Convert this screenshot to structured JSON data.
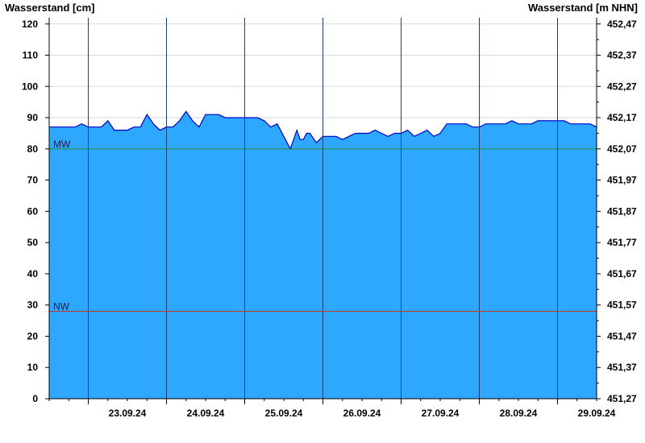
{
  "chart_data": {
    "type": "area",
    "y_left_label": "Wasserstand [cm]",
    "y_right_label": "Wasserstand [m NHN]",
    "ylim": [
      0,
      122
    ],
    "yticks_left": [
      0,
      10,
      20,
      30,
      40,
      50,
      60,
      70,
      80,
      90,
      100,
      110,
      120
    ],
    "yticks_right": [
      "451,27",
      "451,37",
      "451,47",
      "451,57",
      "451,67",
      "451,77",
      "451,87",
      "451,97",
      "452,07",
      "452,17",
      "452,27",
      "452,37",
      "452,47"
    ],
    "x_range": [
      "2024-09-22T12:00",
      "2024-09-29T12:00"
    ],
    "x_tick_labels": [
      "23.09.24",
      "24.09.24",
      "25.09.24",
      "26.09.24",
      "27.09.24",
      "28.09.24",
      "29.09.24"
    ],
    "x_day_boundaries": [
      "2024-09-23",
      "2024-09-24",
      "2024-09-25",
      "2024-09-26",
      "2024-09-27",
      "2024-09-28",
      "2024-09-29"
    ],
    "reference_lines": [
      {
        "label": "MW",
        "value": 80,
        "color": "#2e8b2e"
      },
      {
        "label": "NW",
        "value": 28,
        "color": "#c0392b"
      }
    ],
    "series": [
      {
        "fill": "#2ea7ff",
        "stroke": "#0000c8",
        "x": [
          "2024-09-22T12:00",
          "2024-09-22T14:00",
          "2024-09-22T16:00",
          "2024-09-22T18:00",
          "2024-09-22T20:00",
          "2024-09-22T22:00",
          "2024-09-23T00:00",
          "2024-09-23T02:00",
          "2024-09-23T04:00",
          "2024-09-23T06:00",
          "2024-09-23T08:00",
          "2024-09-23T10:00",
          "2024-09-23T12:00",
          "2024-09-23T14:00",
          "2024-09-23T16:00",
          "2024-09-23T18:00",
          "2024-09-23T20:00",
          "2024-09-23T22:00",
          "2024-09-24T00:00",
          "2024-09-24T02:00",
          "2024-09-24T04:00",
          "2024-09-24T06:00",
          "2024-09-24T08:00",
          "2024-09-24T10:00",
          "2024-09-24T12:00",
          "2024-09-24T14:00",
          "2024-09-24T16:00",
          "2024-09-24T18:00",
          "2024-09-24T20:00",
          "2024-09-24T22:00",
          "2024-09-25T00:00",
          "2024-09-25T02:00",
          "2024-09-25T04:00",
          "2024-09-25T06:00",
          "2024-09-25T08:00",
          "2024-09-25T10:00",
          "2024-09-25T12:00",
          "2024-09-25T14:00",
          "2024-09-25T16:00",
          "2024-09-25T17:00",
          "2024-09-25T18:00",
          "2024-09-25T19:00",
          "2024-09-25T20:00",
          "2024-09-25T22:00",
          "2024-09-26T00:00",
          "2024-09-26T02:00",
          "2024-09-26T04:00",
          "2024-09-26T06:00",
          "2024-09-26T08:00",
          "2024-09-26T10:00",
          "2024-09-26T12:00",
          "2024-09-26T14:00",
          "2024-09-26T16:00",
          "2024-09-26T18:00",
          "2024-09-26T20:00",
          "2024-09-26T22:00",
          "2024-09-27T00:00",
          "2024-09-27T02:00",
          "2024-09-27T04:00",
          "2024-09-27T06:00",
          "2024-09-27T08:00",
          "2024-09-27T10:00",
          "2024-09-27T12:00",
          "2024-09-27T14:00",
          "2024-09-27T16:00",
          "2024-09-27T18:00",
          "2024-09-27T20:00",
          "2024-09-27T22:00",
          "2024-09-28T00:00",
          "2024-09-28T02:00",
          "2024-09-28T04:00",
          "2024-09-28T06:00",
          "2024-09-28T08:00",
          "2024-09-28T10:00",
          "2024-09-28T12:00",
          "2024-09-28T14:00",
          "2024-09-28T16:00",
          "2024-09-28T18:00",
          "2024-09-28T20:00",
          "2024-09-28T22:00",
          "2024-09-29T00:00",
          "2024-09-29T02:00",
          "2024-09-29T04:00",
          "2024-09-29T06:00",
          "2024-09-29T08:00",
          "2024-09-29T10:00",
          "2024-09-29T12:00"
        ],
        "values": [
          87,
          87,
          87,
          87,
          87,
          88,
          87,
          87,
          87,
          89,
          86,
          86,
          86,
          87,
          87,
          91,
          88,
          86,
          87,
          87,
          89,
          92,
          89,
          87,
          91,
          91,
          91,
          90,
          90,
          90,
          90,
          90,
          90,
          89,
          87,
          88,
          84,
          80,
          86,
          83,
          83,
          85,
          85,
          82,
          84,
          84,
          84,
          83,
          84,
          85,
          85,
          85,
          86,
          85,
          84,
          85,
          85,
          86,
          84,
          85,
          86,
          84,
          85,
          88,
          88,
          88,
          88,
          87,
          87,
          88,
          88,
          88,
          88,
          89,
          88,
          88,
          88,
          89,
          89,
          89,
          89,
          89,
          88,
          88,
          88,
          88,
          87
        ]
      }
    ]
  }
}
